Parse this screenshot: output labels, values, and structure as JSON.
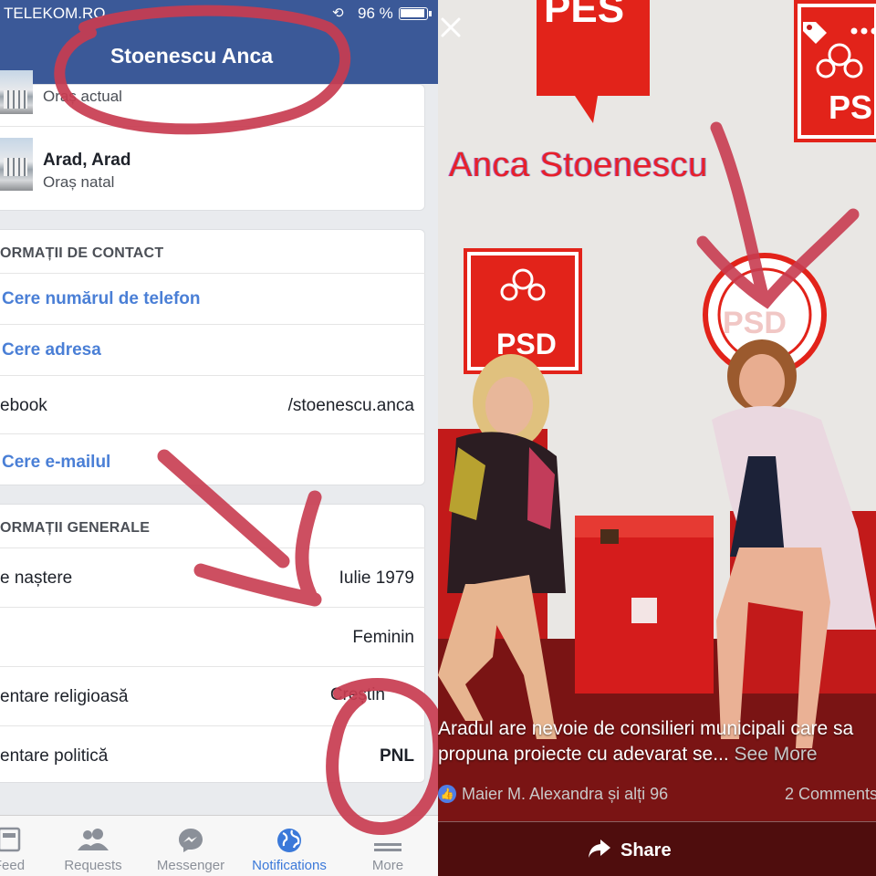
{
  "status_bar": {
    "carrier": "TELEKOM.RO",
    "battery": "96 %"
  },
  "profile": {
    "name": "Stoenescu Anca"
  },
  "places": [
    {
      "title": "",
      "subtitle": "Oraș actual"
    },
    {
      "title": "Arad, Arad",
      "subtitle": "Oraș natal"
    }
  ],
  "contact": {
    "header": "ORMAȚII DE CONTACT",
    "phone_link": "Cere numărul de telefon",
    "address_link": "Cere adresa",
    "facebook_label": "ebook",
    "facebook_value": "/stoenescu.anca",
    "email_link": "Cere e-mailul"
  },
  "general": {
    "header": "ORMAȚII GENERALE",
    "rows": [
      {
        "label": "e naștere",
        "value": "Iulie 1979"
      },
      {
        "label": "",
        "value": "Feminin"
      },
      {
        "label": "entare religioasă",
        "value": "Creștin"
      },
      {
        "label": "entare politică",
        "value": "PNL"
      }
    ]
  },
  "tabs": [
    {
      "label": "Feed",
      "icon": "news-feed-icon"
    },
    {
      "label": "Requests",
      "icon": "friends-icon"
    },
    {
      "label": "Messenger",
      "icon": "messenger-icon"
    },
    {
      "label": "Notifications",
      "icon": "globe-icon",
      "active": true
    },
    {
      "label": "More",
      "icon": "menu-icon"
    }
  ],
  "photo": {
    "overlay_text": "Anca Stoenescu",
    "banner_texts": [
      "PES",
      "PSD",
      "PSD",
      "PSD"
    ],
    "caption": "Aradul are nevoie de consilieri municipali care sa propuna proiecte cu adevarat se...",
    "see_more": "See More",
    "likes": "Maier M. Alexandra și alți 96",
    "comments": "2 Comments",
    "share_label": "Share"
  },
  "colors": {
    "facebook_blue": "#3b5998",
    "link_blue": "#4a7fd6",
    "psd_red": "#e2231a",
    "marker_red": "#c83c50"
  }
}
